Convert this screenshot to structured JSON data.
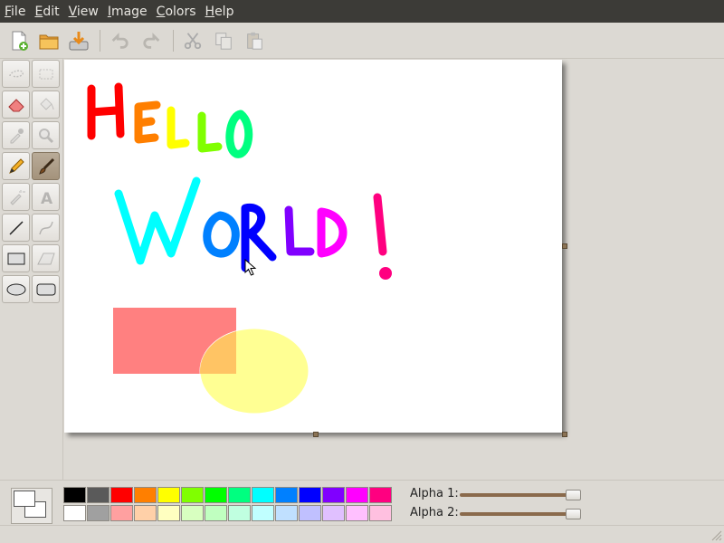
{
  "menu": [
    {
      "mnemonic": "F",
      "rest": "ile"
    },
    {
      "mnemonic": "E",
      "rest": "dit"
    },
    {
      "mnemonic": "V",
      "rest": "iew"
    },
    {
      "mnemonic": "I",
      "rest": "mage"
    },
    {
      "mnemonic": "C",
      "rest": "olors"
    },
    {
      "mnemonic": "H",
      "rest": "elp"
    }
  ],
  "toolbar_icons": [
    "new-file-icon",
    "open-folder-icon",
    "save-icon",
    "undo-icon",
    "redo-icon",
    "cut-icon",
    "copy-icon",
    "paste-icon"
  ],
  "tools": [
    "free-select-icon",
    "rectangle-select-icon",
    "eraser-icon",
    "fill-bucket-icon",
    "color-picker-icon",
    "zoom-icon",
    "pencil-icon",
    "paintbrush-icon",
    "airbrush-icon",
    "text-icon",
    "line-icon",
    "curve-icon",
    "rectangle-icon",
    "polygon-icon",
    "ellipse-icon",
    "rounded-rectangle-icon"
  ],
  "active_tool": "paintbrush-icon",
  "palette": {
    "row1": [
      "#000000",
      "#5a5a5a",
      "#ff0000",
      "#ff7f00",
      "#ffff00",
      "#80ff00",
      "#00ff00",
      "#00ff80",
      "#00ffff",
      "#0080ff",
      "#0000ff",
      "#8000ff",
      "#ff00ff",
      "#ff0080"
    ],
    "row2": [
      "#ffffff",
      "#a0a0a0",
      "#ffa0a0",
      "#ffd0a8",
      "#ffffc0",
      "#d8ffc0",
      "#c0ffc0",
      "#c0ffe0",
      "#c0ffff",
      "#c0e0ff",
      "#c0c0ff",
      "#e0c0ff",
      "#ffc0ff",
      "#ffc0e0"
    ]
  },
  "alpha1": {
    "label": "Alpha 1:",
    "value": 0.95
  },
  "alpha2": {
    "label": "Alpha 2:",
    "value": 0.95
  },
  "drawing": {
    "line1": "HELLO",
    "line2": "WORLD!",
    "rect_color": "#ff8080",
    "ellipse_color": "#ffff80"
  }
}
